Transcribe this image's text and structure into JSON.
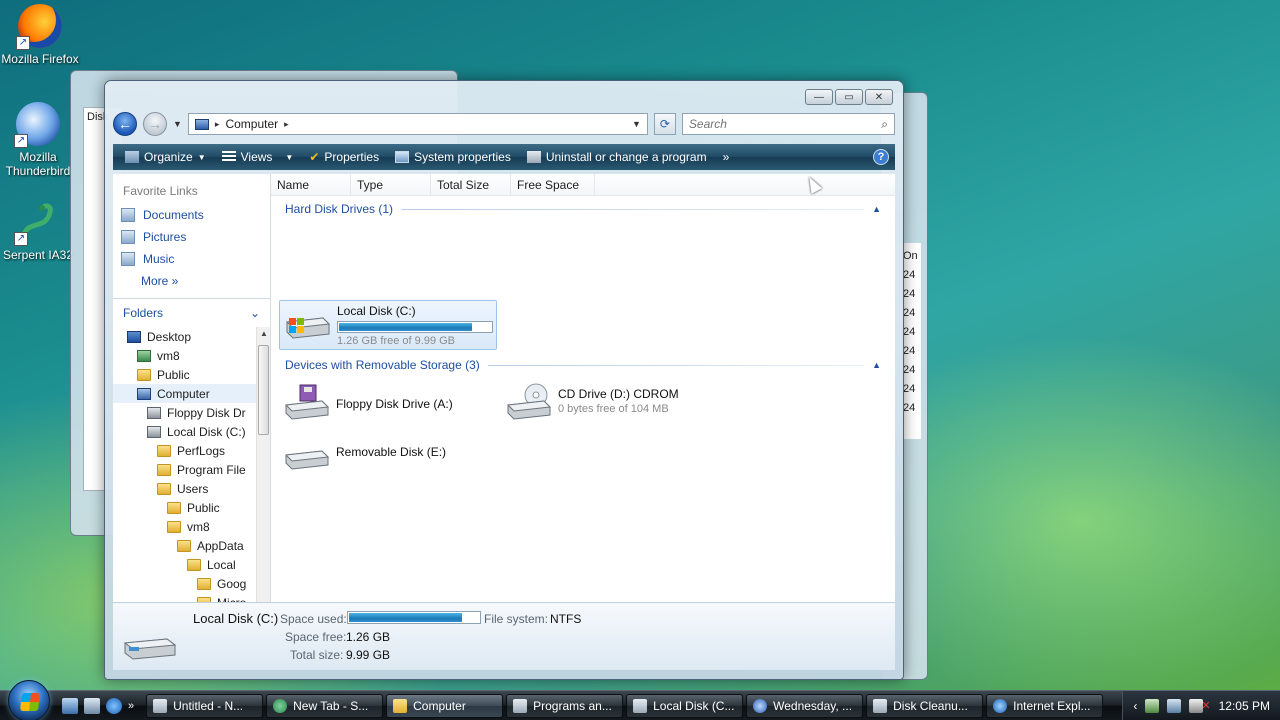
{
  "desktop": {
    "icons": [
      {
        "label": "Mozilla Firefox",
        "icon": "firefox-icon"
      },
      {
        "label": "Mozilla Thunderbird",
        "icon": "thunderbird-icon"
      },
      {
        "label": "Serpent IA32",
        "icon": "serpent-icon"
      }
    ]
  },
  "background_windows": {
    "left_fragment": "Disk",
    "right_column_header": "On",
    "right_column_values": [
      "24",
      "24",
      "24",
      "24",
      "24",
      "24",
      "24",
      "24"
    ]
  },
  "explorer": {
    "controls": {
      "minimize": "—",
      "maximize": "▭",
      "close": "✕"
    },
    "address": {
      "location": "Computer",
      "separator": "▸"
    },
    "search": {
      "placeholder": "Search"
    },
    "commands": {
      "organize": "Organize",
      "views": "Views",
      "properties": "Properties",
      "system_properties": "System properties",
      "uninstall": "Uninstall or change a program",
      "more": "»",
      "help": "?"
    },
    "favorites": {
      "title": "Favorite Links",
      "items": [
        "Documents",
        "Pictures",
        "Music"
      ],
      "more": "More  »"
    },
    "folders": {
      "title": "Folders",
      "tree": [
        {
          "label": "Desktop",
          "icon": "desktop-icon",
          "indent": 0
        },
        {
          "label": "vm8",
          "icon": "user-icon",
          "indent": 1
        },
        {
          "label": "Public",
          "icon": "folder-icon",
          "indent": 1
        },
        {
          "label": "Computer",
          "icon": "computer-icon",
          "indent": 1,
          "selected": true
        },
        {
          "label": "Floppy Disk Dr",
          "icon": "drive-icon",
          "indent": 2
        },
        {
          "label": "Local Disk (C:)",
          "icon": "drive-icon",
          "indent": 2
        },
        {
          "label": "PerfLogs",
          "icon": "folder-icon",
          "indent": 3
        },
        {
          "label": "Program File",
          "icon": "folder-icon",
          "indent": 3
        },
        {
          "label": "Users",
          "icon": "folder-icon",
          "indent": 3
        },
        {
          "label": "Public",
          "icon": "folder-icon",
          "indent": 4
        },
        {
          "label": "vm8",
          "icon": "folder-icon",
          "indent": 4
        },
        {
          "label": "AppData",
          "icon": "folder-icon",
          "indent": 5
        },
        {
          "label": "Local",
          "icon": "folder-icon",
          "indent": 6
        },
        {
          "label": "Goog",
          "icon": "folder-icon",
          "indent": 7
        },
        {
          "label": "Micro",
          "icon": "folder-icon",
          "indent": 7
        }
      ]
    },
    "columns": [
      "Name",
      "Type",
      "Total Size",
      "Free Space"
    ],
    "groups": {
      "hard_disks": {
        "title": "Hard Disk Drives (1)",
        "items": [
          {
            "name": "Local Disk (C:)",
            "free": "1.26 GB free of 9.99 GB",
            "used_fraction": 0.874
          }
        ]
      },
      "removable": {
        "title": "Devices with Removable Storage (3)",
        "items": [
          {
            "name": "Floppy Disk Drive (A:)"
          },
          {
            "name": "CD Drive (D:) CDROM",
            "free": "0 bytes free of 104 MB"
          },
          {
            "name": "Removable Disk (E:)"
          }
        ]
      }
    },
    "details": {
      "name": "Local Disk (C:)",
      "space_used_label": "Space used:",
      "space_used_fraction": 0.874,
      "file_system_label": "File system:",
      "file_system": "NTFS",
      "space_free_label": "Space free:",
      "space_free": "1.26 GB",
      "total_size_label": "Total size:",
      "total_size": "9.99 GB"
    }
  },
  "taskbar": {
    "quick_launch_more": "»",
    "tasks": [
      {
        "label": "Untitled - N...",
        "icon": "notepad-icon"
      },
      {
        "label": "New Tab - S...",
        "icon": "browser-icon"
      },
      {
        "label": "Computer",
        "icon": "folder-icon",
        "active": true
      },
      {
        "label": "Programs an...",
        "icon": "control-panel-icon"
      },
      {
        "label": "Local Disk (C...",
        "icon": "drive-icon"
      },
      {
        "label": "Wednesday, ...",
        "icon": "mail-icon"
      },
      {
        "label": "Disk Cleanu...",
        "icon": "cleanup-icon"
      },
      {
        "label": "Internet Expl...",
        "icon": "ie-icon"
      }
    ],
    "tray": {
      "chevron": "‹",
      "clock": "12:05 PM"
    }
  }
}
